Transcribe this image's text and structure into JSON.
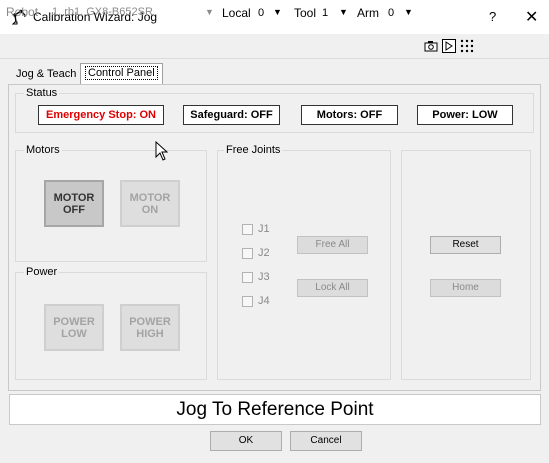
{
  "window": {
    "title": "Calibration Wizard: Jog",
    "help_label": "?",
    "close_label": "✕"
  },
  "toolbar": {
    "robot_label": "Robot",
    "robot_value": "1, rb1, GX8-B652SR",
    "local_label": "Local",
    "local_value": "0",
    "tool_label": "Tool",
    "tool_value": "1",
    "arm_label": "Arm",
    "arm_value": "0",
    "icons": [
      "camera-icon",
      "run-icon",
      "dots-grid-icon"
    ]
  },
  "tabs": [
    {
      "label": "Jog & Teach"
    },
    {
      "label": "Control Panel"
    }
  ],
  "status": {
    "group_label": "Status",
    "items": [
      {
        "label": "Emergency Stop: ON",
        "color": "#e00000"
      },
      {
        "label": "Safeguard: OFF",
        "color": "#000000"
      },
      {
        "label": "Motors: OFF",
        "color": "#000000"
      },
      {
        "label": "Power: LOW",
        "color": "#000000"
      }
    ]
  },
  "motors": {
    "group_label": "Motors",
    "off_label_1": "MOTOR",
    "off_label_2": "OFF",
    "on_label_1": "MOTOR",
    "on_label_2": "ON"
  },
  "power": {
    "group_label": "Power",
    "low_label_1": "POWER",
    "low_label_2": "LOW",
    "high_label_1": "POWER",
    "high_label_2": "HIGH"
  },
  "free_joints": {
    "group_label": "Free Joints",
    "joints": [
      "J1",
      "J2",
      "J3",
      "J4"
    ],
    "free_all_label": "Free All",
    "lock_all_label": "Lock All"
  },
  "right_panel": {
    "reset_label": "Reset",
    "home_label": "Home"
  },
  "reference_text": "Jog To Reference Point",
  "dialog": {
    "ok_label": "OK",
    "cancel_label": "Cancel"
  }
}
